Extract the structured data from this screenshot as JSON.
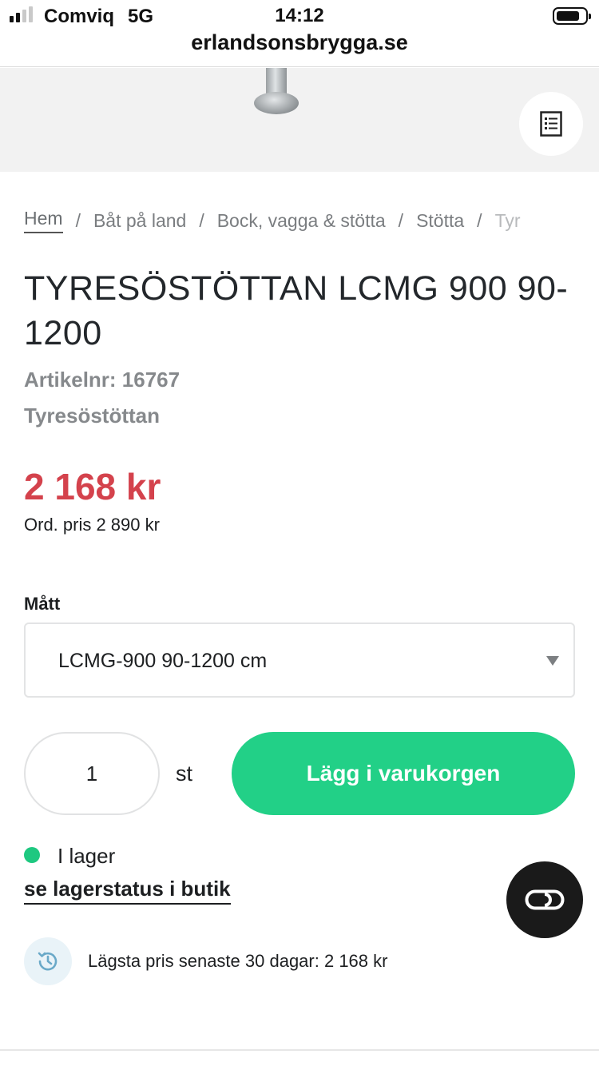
{
  "status_bar": {
    "carrier": "Comviq",
    "network": "5G",
    "time": "14:12",
    "url": "erlandsonsbrygga.se",
    "signal_bars_active": 2,
    "signal_bars_total": 4
  },
  "hero": {
    "spec_icon": "spec-sheet-icon"
  },
  "breadcrumb": {
    "items": [
      "Hem",
      "Båt på land",
      "Bock, vagga & stötta",
      "Stötta",
      "Tyr"
    ],
    "separator": "/"
  },
  "product": {
    "title": "TYRESÖSTÖTTAN LCMG 900 90-1200",
    "article_number": "Artikelnr: 16767",
    "brand": "Tyresöstöttan",
    "price": "2 168 kr",
    "ordinary_price": "Ord. pris 2 890 kr"
  },
  "options": {
    "label": "Mått",
    "selected": "LCMG-900 90-1200 cm"
  },
  "cart": {
    "quantity": "1",
    "unit": "st",
    "add_button": "Lägg i varukorgen"
  },
  "stock": {
    "status": "I lager",
    "store_link": "se lagerstatus i butik"
  },
  "price_history": {
    "text": "Lägsta pris senaste 30 dagar: 2 168 kr",
    "icon": "history-icon"
  },
  "chat": {
    "icon": "chat-icon"
  },
  "colors": {
    "price": "#d4424c",
    "add_button": "#22d087",
    "in_stock": "#1ec880",
    "chat_button": "#1a1a1a"
  }
}
